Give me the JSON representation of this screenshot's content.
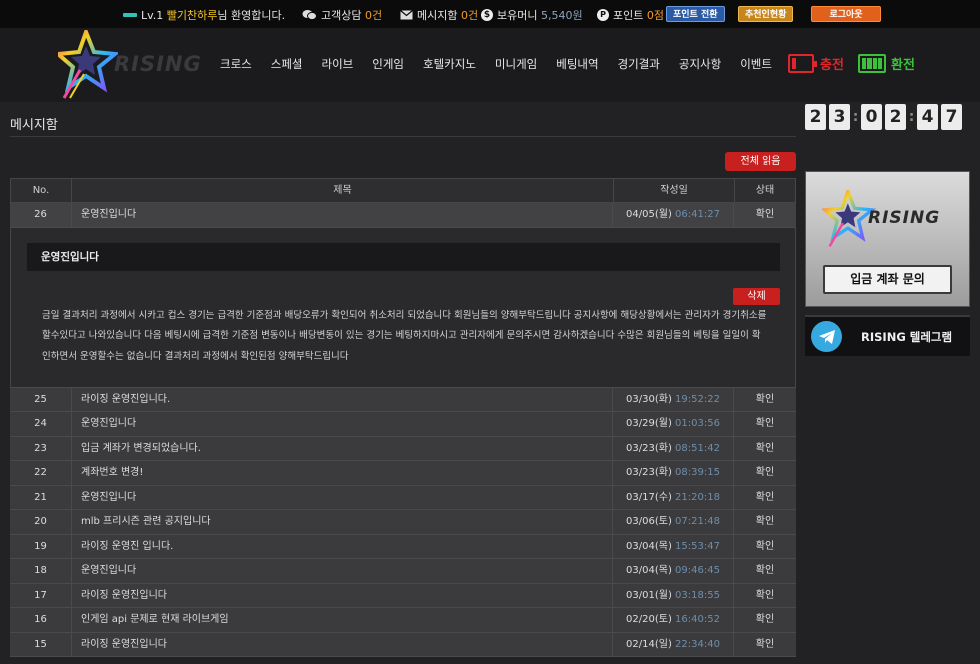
{
  "topbar": {
    "level": "Lv.1",
    "nickname": "빨기찬하루",
    "welcome": "님 환영합니다.",
    "support_label": "고객상담",
    "support_count": "0건",
    "message_label": "메시지함",
    "message_count": "0건",
    "money_label": "보유머니",
    "money_value": "5,540원",
    "point_label": "포인트",
    "point_value": "0점",
    "point_convert_btn": "포인트 전환",
    "recommend_btn": "추천인현황",
    "logout_btn": "로그아웃",
    "icons": {
      "level": "level-bar-icon",
      "support": "chat-icon",
      "message": "envelope-icon",
      "money": "dollar-icon",
      "point": "point-icon"
    }
  },
  "header": {
    "logo_text": "RISING",
    "nav": [
      "크로스",
      "스페셜",
      "라이브",
      "인게임",
      "호텔카지노",
      "미니게임",
      "베팅내역",
      "경기결과",
      "공지사항",
      "이벤트"
    ],
    "charge_label": "충전",
    "exchange_label": "환전",
    "colors": {
      "charge": "#e0262a",
      "exchange": "#3ac23a"
    }
  },
  "main": {
    "page_title": "메시지함",
    "read_all_btn": "전체 읽음",
    "columns": [
      "No.",
      "제목",
      "작성일",
      "상태"
    ],
    "open_message": {
      "no": "26",
      "title": "운영진입니다",
      "date": "04/05(월)",
      "time": "06:41:27",
      "state": "확인",
      "detail_title": "운영진입니다",
      "delete_btn": "삭제",
      "body": "금일 결과처리 과정에서 시카고 컵스 경기는 급격한 기준점과 배당오류가 확인되어 취소처리 되었습니다 회원님들의 양해부탁드립니다 공지사항에 해당상황에서는 관리자가 경기취소를 할수있다고 나와있습니다 다음 베팅시에 급격한 기준점 변동이나 배당변동이 있는 경기는 베팅하지마시고 관리자에게 문의주시면 감사하겠습니다 수많은 회원님들의 베팅을 일일이 확인하면서 운영할수는 없습니다 결과처리 과정에서 확인된점 양해부탁드립니다"
    },
    "rows": [
      {
        "no": "25",
        "title": "라이징 운영진입니다.",
        "date": "03/30(화)",
        "time": "19:52:22",
        "state": "확인"
      },
      {
        "no": "24",
        "title": "운영진입니다",
        "date": "03/29(월)",
        "time": "01:03:56",
        "state": "확인"
      },
      {
        "no": "23",
        "title": "입금 계좌가 변경되었습니다.",
        "date": "03/23(화)",
        "time": "08:51:42",
        "state": "확인"
      },
      {
        "no": "22",
        "title": "계좌번호 변경!",
        "date": "03/23(화)",
        "time": "08:39:15",
        "state": "확인"
      },
      {
        "no": "21",
        "title": "운영진입니다",
        "date": "03/17(수)",
        "time": "21:20:18",
        "state": "확인"
      },
      {
        "no": "20",
        "title": "mlb 프리시즌 관련 공지입니다",
        "date": "03/06(토)",
        "time": "07:21:48",
        "state": "확인"
      },
      {
        "no": "19",
        "title": "라이징 운영진 입니다.",
        "date": "03/04(목)",
        "time": "15:53:47",
        "state": "확인"
      },
      {
        "no": "18",
        "title": "운영진입니다",
        "date": "03/04(목)",
        "time": "09:46:45",
        "state": "확인"
      },
      {
        "no": "17",
        "title": "라이징 운영진입니다",
        "date": "03/01(월)",
        "time": "03:18:55",
        "state": "확인"
      },
      {
        "no": "16",
        "title": "인게임 api 문제로 현재 라이브게임",
        "date": "02/20(토)",
        "time": "16:40:52",
        "state": "확인"
      },
      {
        "no": "15",
        "title": "라이징 운영진입니다",
        "date": "02/14(일)",
        "time": "22:34:40",
        "state": "확인"
      }
    ]
  },
  "sidebar": {
    "clock": [
      "2",
      "3",
      "0",
      "2",
      "4",
      "7"
    ],
    "clock_sep": ":",
    "deposit_banner_logo": "RISING",
    "deposit_banner_btn": "입금 계좌 문의",
    "telegram_label": "RISING 텔레그램"
  }
}
